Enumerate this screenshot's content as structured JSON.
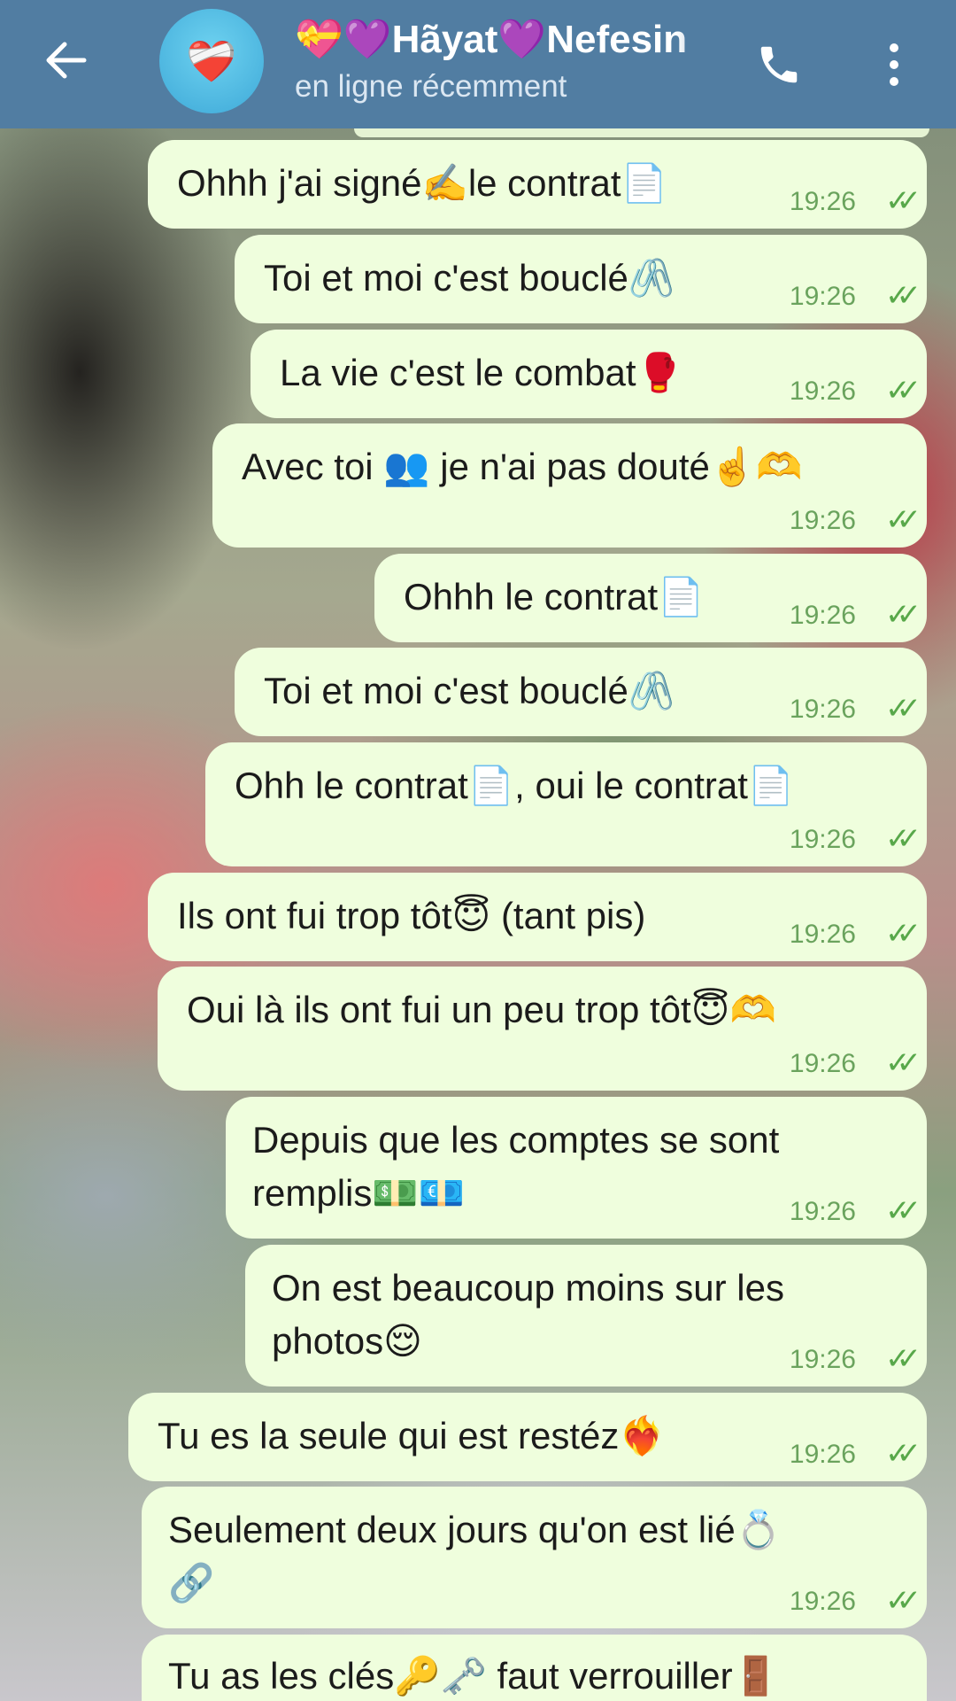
{
  "header": {
    "back_icon": "arrow-left-icon",
    "avatar_emoji": "❤️‍🩹",
    "contact_name": "💝💜Hãyat💜Nefesin",
    "status": "en ligne récemment",
    "call_icon": "phone-icon",
    "menu_icon": "vertical-dots-icon"
  },
  "messages": [
    {
      "text": "Ohhh j'ai signé✍️le contrat📄",
      "time": "19:26",
      "ticks": "✓✓"
    },
    {
      "text": "Toi et moi c'est bouclé🖇️",
      "time": "19:26",
      "ticks": "✓✓"
    },
    {
      "text": "La vie c'est le combat🥊",
      "time": "19:26",
      "ticks": "✓✓"
    },
    {
      "text": "Avec toi 👥 je n'ai pas douté☝️🫶",
      "time": "19:26",
      "ticks": "✓✓"
    },
    {
      "text": "Ohhh le contrat📄",
      "time": "19:26",
      "ticks": "✓✓"
    },
    {
      "text": "Toi et moi c'est bouclé🖇️",
      "time": "19:26",
      "ticks": "✓✓"
    },
    {
      "text": "Ohh le contrat📄, oui le contrat📄",
      "time": "19:26",
      "ticks": "✓✓"
    },
    {
      "text": "Ils ont fui trop tôt😇 (tant pis)",
      "time": "19:26",
      "ticks": "✓✓"
    },
    {
      "text": "Oui là ils ont fui un peu trop tôt😇🫶",
      "time": "19:26",
      "ticks": "✓✓"
    },
    {
      "line1": "Depuis que les comptes se sont",
      "line2": "remplis💵💶",
      "time": "19:26",
      "ticks": "✓✓"
    },
    {
      "line1": "On est beaucoup moins sur les",
      "line2": "photos😌",
      "time": "19:26",
      "ticks": "✓✓"
    },
    {
      "text": "Tu es la seule qui est restéz❤️‍🔥",
      "time": "19:26",
      "ticks": "✓✓"
    },
    {
      "line1": "Seulement deux jours qu'on est lié💍",
      "line2": "🔗",
      "time": "19:26",
      "ticks": "✓✓"
    },
    {
      "text": "Tu as les clés🔑🗝️ faut verrouiller🚪"
    }
  ]
}
